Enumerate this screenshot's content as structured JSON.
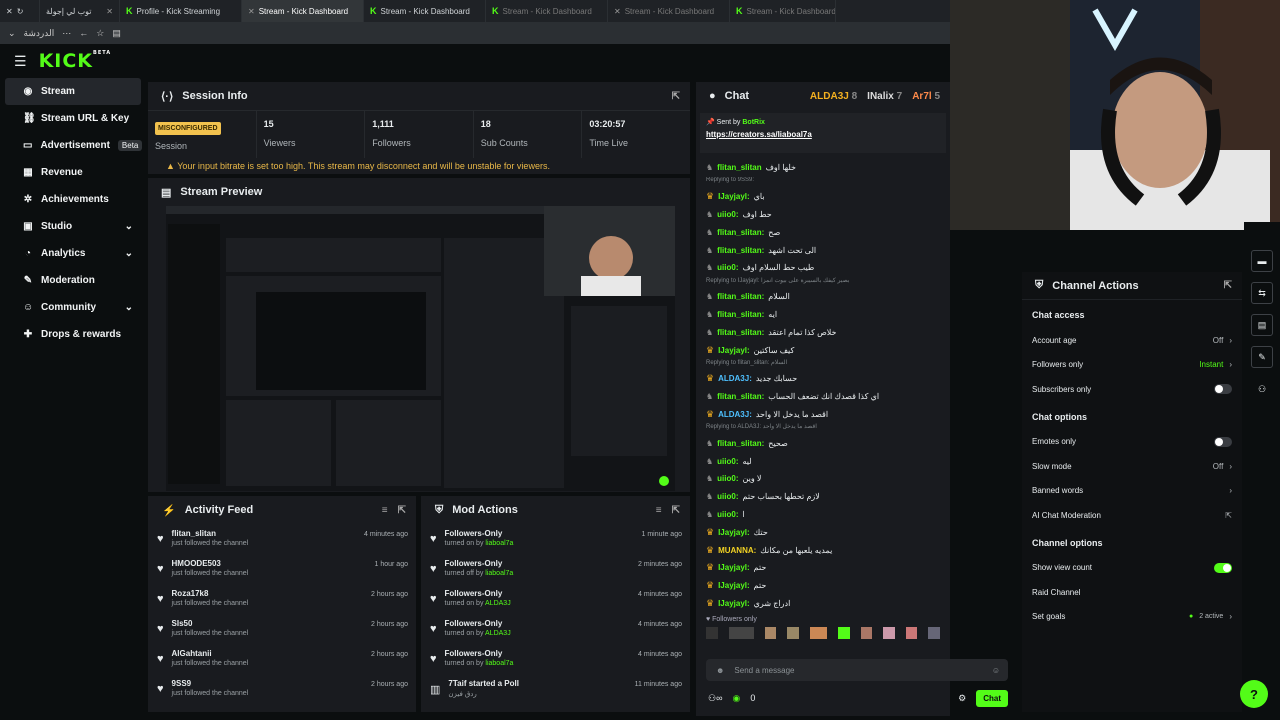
{
  "browser": {
    "tabs": [
      {
        "label": "توب لي إجولة",
        "icon": ""
      },
      {
        "label": "Profile - Kick Streaming",
        "icon": "K"
      },
      {
        "label": "Stream - Kick Dashboard",
        "icon": "K",
        "active": true
      },
      {
        "label": "Stream - Kick Dashboard",
        "icon": "K"
      },
      {
        "label": "Stream - Kick Dashboard",
        "icon": "K"
      },
      {
        "label": "Stream - Kick Dashboard",
        "icon": "K"
      },
      {
        "label": "Stream - Kick Dashboard",
        "icon": "K"
      }
    ],
    "addr_label": "الدردشة"
  },
  "kick": {
    "logo": "KICK",
    "beta": "BETA"
  },
  "sidebar": {
    "items": [
      {
        "label": "Stream",
        "icon": "stream-icon",
        "active": true
      },
      {
        "label": "Stream URL & Key",
        "icon": "link-icon"
      },
      {
        "label": "Advertisement",
        "icon": "ad-icon",
        "badge": "Beta"
      },
      {
        "label": "Revenue",
        "icon": "revenue-icon"
      },
      {
        "label": "Achievements",
        "icon": "gear-icon"
      },
      {
        "label": "Studio",
        "icon": "studio-icon",
        "chevron": true
      },
      {
        "label": "Analytics",
        "icon": "analytics-icon",
        "chevron": true
      },
      {
        "label": "Moderation",
        "icon": "wrench-icon"
      },
      {
        "label": "Community",
        "icon": "community-icon",
        "chevron": true
      },
      {
        "label": "Drops & rewards",
        "icon": "gift-icon"
      }
    ]
  },
  "session": {
    "title": "Session Info",
    "badge": "MISCONFIGURED",
    "badge_label": "Session",
    "stats": [
      {
        "value": "15",
        "label": "Viewers"
      },
      {
        "value": "1,111",
        "label": "Followers"
      },
      {
        "value": "18",
        "label": "Sub Counts"
      },
      {
        "value": "03:20:57",
        "label": "Time Live"
      }
    ],
    "warning": "Your input bitrate is set too high. This stream may disconnect and will be unstable for viewers."
  },
  "preview": {
    "title": "Stream Preview"
  },
  "activity": {
    "title": "Activity Feed",
    "items": [
      {
        "name": "flitan_slitan",
        "sub": "just followed the channel",
        "time": "4 minutes ago"
      },
      {
        "name": "HMOODE503",
        "sub": "just followed the channel",
        "time": "1 hour ago"
      },
      {
        "name": "Roza17k8",
        "sub": "just followed the channel",
        "time": "2 hours ago"
      },
      {
        "name": "SIs50",
        "sub": "just followed the channel",
        "time": "2 hours ago"
      },
      {
        "name": "AlGahtanii",
        "sub": "just followed the channel",
        "time": "2 hours ago"
      },
      {
        "name": "9SS9",
        "sub": "just followed the channel",
        "time": "2 hours ago"
      }
    ]
  },
  "mod": {
    "title": "Mod Actions",
    "items": [
      {
        "name": "Followers-Only",
        "sub": "turned on by",
        "who": "liaboal7a",
        "time": "1 minute ago"
      },
      {
        "name": "Followers-Only",
        "sub": "turned off by",
        "who": "liaboal7a",
        "time": "2 minutes ago"
      },
      {
        "name": "Followers-Only",
        "sub": "turned on by",
        "who": "ALDA3J",
        "time": "4 minutes ago"
      },
      {
        "name": "Followers-Only",
        "sub": "turned on by",
        "who": "ALDA3J",
        "time": "4 minutes ago"
      },
      {
        "name": "Followers-Only",
        "sub": "turned on by",
        "who": "liaboal7a",
        "time": "4 minutes ago"
      },
      {
        "name": "7Taif started a Poll",
        "sub": "ردق فيزن",
        "who": "",
        "time": "11 minutes ago"
      }
    ]
  },
  "chat": {
    "title": "Chat",
    "top": [
      {
        "name": "ALDA3J",
        "n": "8"
      },
      {
        "name": "INalix",
        "n": "7"
      },
      {
        "name": "Ar7l",
        "n": "5"
      }
    ],
    "pin_sent": "Sent by",
    "pin_bot": "BotRix",
    "pin_link": "https://creators.sa/liaboal7a",
    "messages": [
      {
        "u": "flitan_slitan",
        "t": "خلها اوف",
        "c": "#53fc18"
      },
      {
        "reply": "Replying to 9SS9:"
      },
      {
        "u": "IJayjayl:",
        "t": "باي",
        "c": "#53fc18",
        "crown": true
      },
      {
        "u": "uiio0:",
        "t": "حط اوف",
        "c": "#53fc18"
      },
      {
        "u": "flitan_slitan:",
        "t": "صح",
        "c": "#53fc18"
      },
      {
        "u": "flitan_slitan:",
        "t": "الى تحت اشهد",
        "c": "#53fc18"
      },
      {
        "u": "uiio0:",
        "t": "طيب حط السلام اوف",
        "c": "#53fc18"
      },
      {
        "reply": "Replying to IJayjayl: بصير كيفك بالسيبرة على بيوت انمزا"
      },
      {
        "u": "flitan_slitan:",
        "t": "السلام",
        "c": "#53fc18"
      },
      {
        "u": "flitan_slitan:",
        "t": "ايه",
        "c": "#53fc18"
      },
      {
        "u": "flitan_slitan:",
        "t": "خلاص كذا تمام اعتقد",
        "c": "#53fc18"
      },
      {
        "u": "IJayjayl:",
        "t": "كيف ساكتين",
        "c": "#53fc18",
        "crown": true
      },
      {
        "reply": "Replying to flitan_slitan: السلام"
      },
      {
        "u": "ALDA3J:",
        "t": "حسابك جديد",
        "c": "#4ec0ff",
        "crown": true
      },
      {
        "u": "flitan_slitan:",
        "t": "اي كذا قصدك انك تضعف الحساب",
        "c": "#53fc18"
      },
      {
        "u": "ALDA3J:",
        "t": "اقصد ما يدخل الا واحد",
        "c": "#4ec0ff",
        "crown": true
      },
      {
        "reply": "Replying to ALDA3J: اقصد ما يدخل الا واحد"
      },
      {
        "u": "flitan_slitan:",
        "t": "صحيح",
        "c": "#53fc18"
      },
      {
        "u": "uiio0:",
        "t": "ليه",
        "c": "#53fc18"
      },
      {
        "u": "uiio0:",
        "t": "لا وين",
        "c": "#53fc18"
      },
      {
        "u": "uiio0:",
        "t": "لازم تحطها بحساب حتم",
        "c": "#53fc18"
      },
      {
        "u": "uiio0:",
        "t": "ا",
        "c": "#53fc18"
      },
      {
        "u": "IJayjayl:",
        "t": "حتك",
        "c": "#53fc18",
        "crown": true
      },
      {
        "u": "MUANNA:",
        "t": "يمديه يلعبها من مكانك",
        "c": "#f3d324",
        "crown": true
      },
      {
        "u": "IJayjayl:",
        "t": "حتم",
        "c": "#53fc18",
        "crown": true
      },
      {
        "u": "IJayjayl:",
        "t": "حتم",
        "c": "#53fc18",
        "crown": true
      },
      {
        "u": "IJayjayl:",
        "t": "ادراج شري",
        "c": "#53fc18",
        "crown": true
      }
    ],
    "followers_only": "Followers only",
    "placeholder": "Send a message",
    "count": "0",
    "send": "Chat"
  },
  "channel": {
    "title": "Channel Actions",
    "chat_access": "Chat access",
    "account_age": "Account age",
    "account_age_val": "Off",
    "followers_only": "Followers only",
    "followers_only_val": "Instant",
    "subscribers_only": "Subscribers only",
    "chat_options": "Chat options",
    "emotes_only": "Emotes only",
    "slow_mode": "Slow mode",
    "slow_mode_val": "Off",
    "banned_words": "Banned words",
    "ai_mod": "AI Chat Moderation",
    "channel_options": "Channel options",
    "show_view": "Show view count",
    "raid": "Raid Channel",
    "set_goals": "Set goals",
    "set_goals_val": "2 active"
  },
  "colors": {
    "accent": "#53fc18",
    "panel": "#191b1f",
    "bg": "#0b0e0f"
  }
}
